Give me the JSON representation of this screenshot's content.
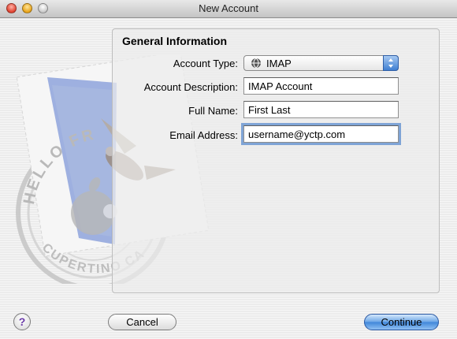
{
  "window": {
    "title": "New Account"
  },
  "section": {
    "title": "General Information"
  },
  "form": {
    "account_type": {
      "label": "Account Type:",
      "value": "IMAP",
      "icon": "globe-icon"
    },
    "account_description": {
      "label": "Account Description:",
      "value": "IMAP Account"
    },
    "full_name": {
      "label": "Full Name:",
      "value": "First Last"
    },
    "email_address": {
      "label": "Email Address:",
      "value": "username@yctp.com"
    }
  },
  "stamp": {
    "text_top": "HELLO FR",
    "text_bottom": "CUPERTINO CA"
  },
  "buttons": {
    "help": "?",
    "cancel": "Cancel",
    "continue": "Continue"
  },
  "colors": {
    "focus_ring": "#7fa4d6",
    "default_button": "#3f86da",
    "popup_arrow": "#3f7fd2"
  }
}
